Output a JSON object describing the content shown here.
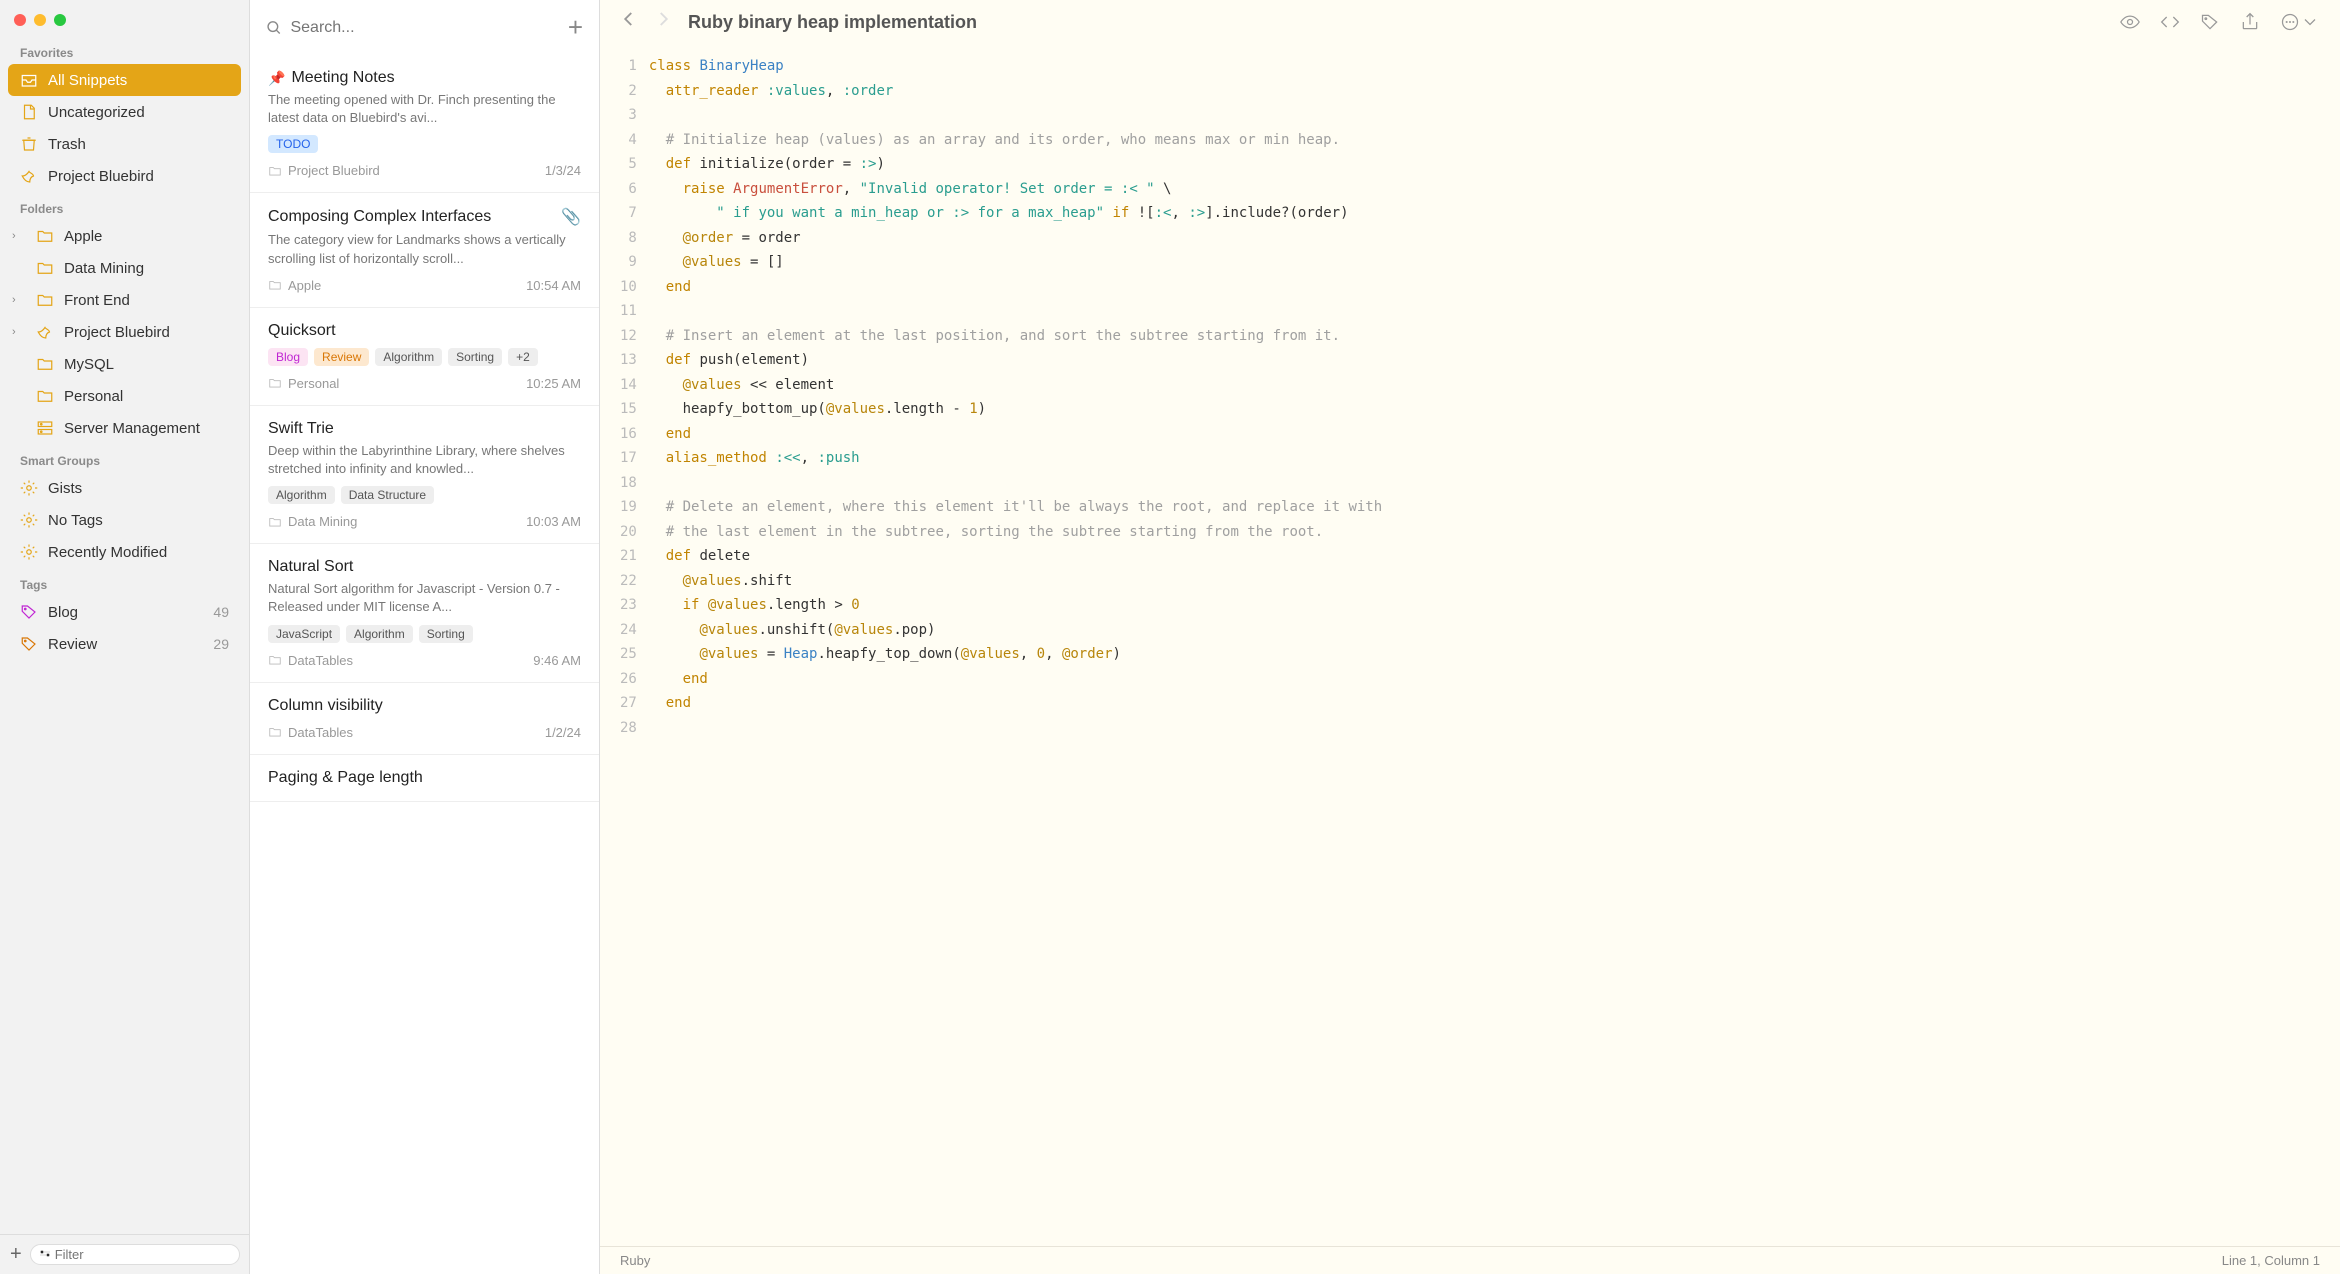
{
  "search": {
    "placeholder": "Search..."
  },
  "filter": {
    "placeholder": "Filter"
  },
  "sidebar": {
    "favorites_header": "Favorites",
    "favorites": [
      {
        "label": "All Snippets",
        "icon": "inbox"
      },
      {
        "label": "Uncategorized",
        "icon": "doc"
      },
      {
        "label": "Trash",
        "icon": "trash"
      },
      {
        "label": "Project Bluebird",
        "icon": "bird"
      }
    ],
    "folders_header": "Folders",
    "folders": [
      {
        "label": "Apple",
        "expandable": true
      },
      {
        "label": "Data Mining",
        "expandable": false
      },
      {
        "label": "Front End",
        "expandable": true
      },
      {
        "label": "Project Bluebird",
        "expandable": true,
        "icon": "bird"
      },
      {
        "label": "MySQL",
        "expandable": false
      },
      {
        "label": "Personal",
        "expandable": false
      },
      {
        "label": "Server Management",
        "expandable": false,
        "icon": "server"
      }
    ],
    "smart_header": "Smart Groups",
    "smart": [
      {
        "label": "Gists"
      },
      {
        "label": "No Tags"
      },
      {
        "label": "Recently Modified"
      }
    ],
    "tags_header": "Tags",
    "tags": [
      {
        "label": "Blog",
        "count": "49",
        "color": "pink"
      },
      {
        "label": "Review",
        "count": "29",
        "color": "orange"
      }
    ]
  },
  "snippets": [
    {
      "title": "Meeting Notes",
      "pinned": true,
      "excerpt": "The meeting opened with Dr. Finch presenting the latest data on Bluebird's avi...",
      "tags": [
        {
          "label": "TODO",
          "color": "blue"
        }
      ],
      "folder": "Project Bluebird",
      "date": "1/3/24"
    },
    {
      "title": "Composing Complex Interfaces",
      "attachment": true,
      "excerpt": "The category view for Landmarks shows a vertically scrolling list of horizontally scroll...",
      "folder": "Apple",
      "date": "10:54 AM"
    },
    {
      "title": "Quicksort",
      "tags": [
        {
          "label": "Blog",
          "color": "pink"
        },
        {
          "label": "Review",
          "color": "orange"
        },
        {
          "label": "Algorithm",
          "color": ""
        },
        {
          "label": "Sorting",
          "color": ""
        },
        {
          "label": "+2",
          "color": ""
        }
      ],
      "folder": "Personal",
      "date": "10:25 AM"
    },
    {
      "title": "Swift Trie",
      "excerpt": "Deep within the Labyrinthine Library, where shelves stretched into infinity and knowled...",
      "tags": [
        {
          "label": "Algorithm",
          "color": ""
        },
        {
          "label": "Data Structure",
          "color": ""
        }
      ],
      "folder": "Data Mining",
      "date": "10:03 AM"
    },
    {
      "title": "Natural Sort",
      "excerpt": "Natural Sort algorithm for Javascript - Version 0.7 - Released under MIT license A...",
      "tags": [
        {
          "label": "JavaScript",
          "color": ""
        },
        {
          "label": "Algorithm",
          "color": ""
        },
        {
          "label": "Sorting",
          "color": ""
        }
      ],
      "folder": "DataTables",
      "date": "9:46 AM"
    },
    {
      "title": "Column visibility",
      "folder": "DataTables",
      "date": "1/2/24"
    },
    {
      "title": "Paging & Page length"
    }
  ],
  "editor": {
    "title": "Ruby binary heap implementation",
    "language": "Ruby",
    "cursor": "Line 1, Column 1"
  }
}
